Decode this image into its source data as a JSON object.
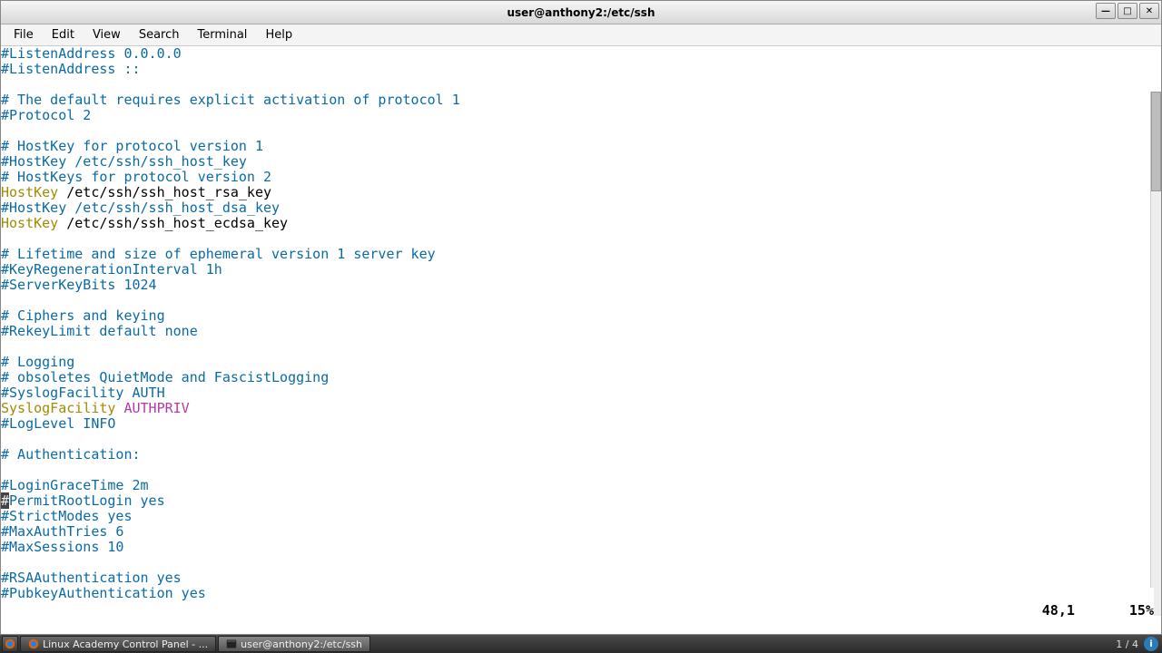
{
  "window": {
    "title": "user@anthony2:/etc/ssh"
  },
  "menu": [
    "File",
    "Edit",
    "View",
    "Search",
    "Terminal",
    "Help"
  ],
  "lines": [
    {
      "t": "comment",
      "text": "#ListenAddress 0.0.0.0"
    },
    {
      "t": "comment",
      "text": "#ListenAddress ::"
    },
    {
      "t": "blank",
      "text": ""
    },
    {
      "t": "comment",
      "text": "# The default requires explicit activation of protocol 1"
    },
    {
      "t": "comment",
      "text": "#Protocol 2"
    },
    {
      "t": "blank",
      "text": ""
    },
    {
      "t": "comment",
      "text": "# HostKey for protocol version 1"
    },
    {
      "t": "comment",
      "text": "#HostKey /etc/ssh/ssh_host_key"
    },
    {
      "t": "comment",
      "text": "# HostKeys for protocol version 2"
    },
    {
      "t": "kv",
      "k": "HostKey",
      "v": " /etc/ssh/ssh_host_rsa_key"
    },
    {
      "t": "comment",
      "text": "#HostKey /etc/ssh/ssh_host_dsa_key"
    },
    {
      "t": "kv",
      "k": "HostKey",
      "v": " /etc/ssh/ssh_host_ecdsa_key"
    },
    {
      "t": "blank",
      "text": ""
    },
    {
      "t": "comment",
      "text": "# Lifetime and size of ephemeral version 1 server key"
    },
    {
      "t": "comment",
      "text": "#KeyRegenerationInterval 1h"
    },
    {
      "t": "comment",
      "text": "#ServerKeyBits 1024"
    },
    {
      "t": "blank",
      "text": ""
    },
    {
      "t": "comment",
      "text": "# Ciphers and keying"
    },
    {
      "t": "comment",
      "text": "#RekeyLimit default none"
    },
    {
      "t": "blank",
      "text": ""
    },
    {
      "t": "comment",
      "text": "# Logging"
    },
    {
      "t": "comment",
      "text": "# obsoletes QuietMode and FascistLogging"
    },
    {
      "t": "comment",
      "text": "#SyslogFacility AUTH"
    },
    {
      "t": "kv2",
      "k": "SyslogFacility",
      "v": " AUTHPRIV"
    },
    {
      "t": "comment",
      "text": "#LogLevel INFO"
    },
    {
      "t": "blank",
      "text": ""
    },
    {
      "t": "comment",
      "text": "# Authentication:"
    },
    {
      "t": "blank",
      "text": ""
    },
    {
      "t": "comment",
      "text": "#LoginGraceTime 2m"
    },
    {
      "t": "cursor",
      "hash": "#",
      "rest": "PermitRootLogin yes"
    },
    {
      "t": "comment",
      "text": "#StrictModes yes"
    },
    {
      "t": "comment",
      "text": "#MaxAuthTries 6"
    },
    {
      "t": "comment",
      "text": "#MaxSessions 10"
    },
    {
      "t": "blank",
      "text": ""
    },
    {
      "t": "comment",
      "text": "#RSAAuthentication yes"
    },
    {
      "t": "comment",
      "text": "#PubkeyAuthentication yes"
    }
  ],
  "status": {
    "pos": "48,1",
    "pct": "15%"
  },
  "taskbar": {
    "items": [
      {
        "label": "Linux Academy Control Panel - ...",
        "active": false,
        "icon": "firefox"
      },
      {
        "label": "user@anthony2:/etc/ssh",
        "active": true,
        "icon": "term"
      }
    ],
    "pager": "1 / 4"
  }
}
